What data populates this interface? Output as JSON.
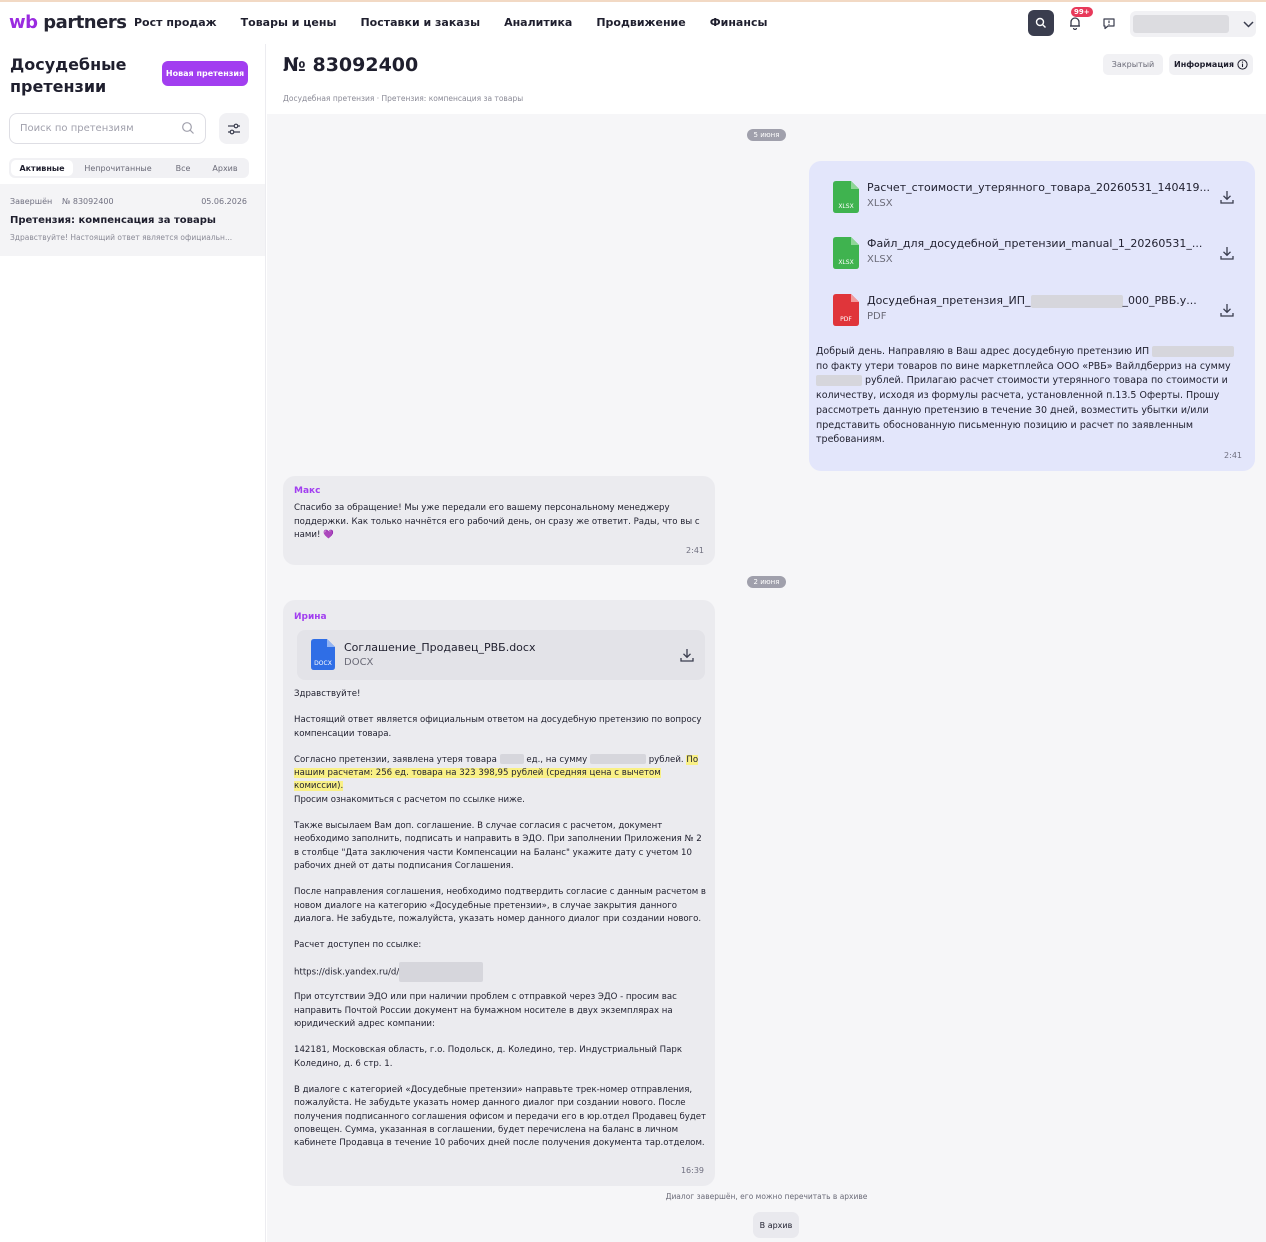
{
  "header": {
    "logo_wb": "wb",
    "logo_partners": "partners",
    "nav": [
      "Рост продаж",
      "Товары и цены",
      "Поставки и заказы",
      "Аналитика",
      "Продвижение",
      "Финансы"
    ],
    "notification_badge": "99+"
  },
  "sidebar": {
    "title": "Досудебные претензии",
    "new_button": "Новая претензия",
    "search_placeholder": "Поиск по претензиям",
    "tabs": [
      "Активные",
      "Непрочитанные",
      "Все",
      "Архив"
    ],
    "active_tab": "Активные",
    "claim": {
      "status": "Завершён",
      "number": "№ 83092400",
      "date": "05.06.2026",
      "title": "Претензия: компенсация за товары",
      "preview": "Здравствуйте! Настоящий ответ является официальн..."
    }
  },
  "main": {
    "title": "№ 83092400",
    "closed_label": "Закрытый",
    "info_label": "Информация",
    "breadcrumb": "Досудебная претензия · Претензия: компенсация за товары",
    "date_1": "5 июня",
    "date_2": "2 июня",
    "outgoing": {
      "files": [
        {
          "name": "Расчет_стоимости_утерянного_товара_20260531_140419...",
          "ext": "XLSX",
          "icon_label": "XLSX",
          "color": "#3fb34f"
        },
        {
          "name": "Файл_для_досудебной_претензии_manual_1_20260531_...",
          "ext": "XLSX",
          "icon_label": "XLSX",
          "color": "#3fb34f"
        },
        {
          "name_a": "Досудебная_претензия_ИП_",
          "name_b": "_000_РВБ.у...",
          "ext": "PDF",
          "icon_label": "PDF",
          "color": "#e0353a"
        }
      ],
      "text_1": "Добрый день. Направляю в Ваш адрес досудебную претензию ИП",
      "text_2": "по факту утери товаров по вине маркетплейса ООО «РВБ» Вайлдберриз на сумму",
      "text_3": "рублей. Прилагаю расчет стоимости утерянного товара по стоимости и количеству, исходя из формулы расчета, установленной п.13.5 Оферты. Прошу рассмотреть данную претензию в течение 30 дней, возместить убытки и/или представить обоснованную письменную позицию и расчет по заявленным требованиям.",
      "time": "2:41"
    },
    "reply_1": {
      "author": "Макс",
      "text": "Спасибо за обращение! Мы уже передали его вашему персональному менеджеру поддержки. Как только начнётся его рабочий день, он сразу же ответит. Рады, что вы с нами! 💜",
      "time": "2:41"
    },
    "reply_2": {
      "author": "Ирина",
      "file_name": "Соглашение_Продавец_РВБ.docx",
      "file_ext": "DOCX",
      "file_icon_label": "DOCX",
      "greeting": "Здравствуйте!",
      "p1": "Настоящий ответ является официальным ответом на досудебную претензию по вопросу компенсации товара.",
      "p2_a": "Согласно претензии, заявлена утеря товара",
      "p2_b": "ед., на сумму",
      "p2_c": "рублей.",
      "p2_hl": "По нашим расчетам: 256 ед. товара на 323 398,95 рублей (средняя цена с вычетом комиссии).",
      "p2_d": "Просим ознакомиться с расчетом по ссылке ниже.",
      "p3": "Также высылаем Вам доп. соглашение. В случае согласия с расчетом, документ необходимо заполнить, подписать и направить в ЭДО. При заполнении Приложения № 2 в столбце \"Дата заключения части Компенсации на Баланс\" укажите дату с учетом 10 рабочих дней от даты подписания Соглашения.",
      "p4": "После направления соглашения, необходимо подтвердить согласие с данным расчетом в новом диалоге на категорию «Досудебные претензии», в случае закрытия данного диалога. Не забудьте, пожалуйста, указать номер данного диалог при создании нового.",
      "p5": "Расчет доступен по ссылке:",
      "link": "https://disk.yandex.ru/d/",
      "p6": "При отсутствии ЭДО или при наличии проблем с отправкой через ЭДО - просим вас направить Почтой России документ на бумажном носителе в двух экземплярах на юридический адрес компании:",
      "p7": "142181, Московская область, г.о. Подольск, д. Коледино, тер. Индустриальный Парк Коледино, д. 6 стр. 1.",
      "p8": "В диалоге с категорией «Досудебные претензии» направьте трек-номер отправления, пожалуйста. Не забудьте указать номер данного диалог при создании нового. После получения подписанного соглашения офисом и передачи его в юр.отдел Продавец будет оповещен. Сумма, указанная в соглашении, будет перечислена на баланс в личном кабинете Продавца в течение 10 рабочих дней после получения документа тар.отделом.",
      "time": "16:39"
    },
    "closed_note": "Диалог завершён, его можно перечитать в архиве",
    "archive_button": "В архив"
  },
  "colors": {
    "accent": "#a23ef0",
    "outgoing_bg": "#e3e6fb",
    "incoming_bg": "#ebebef",
    "highlight": "#f9f086"
  }
}
